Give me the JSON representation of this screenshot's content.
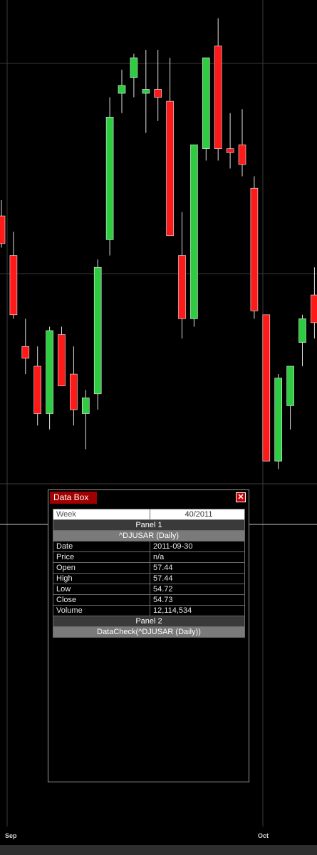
{
  "x_axis": {
    "labels": [
      "Sep",
      "Oct"
    ]
  },
  "colors": {
    "background": "#000000",
    "up_candle": "#2ecc40",
    "down_candle": "#ff1a1a",
    "grid": "#3a3a3a",
    "crosshair": "#c8c8c8"
  },
  "chart_data": {
    "type": "candlestick",
    "title": "",
    "xlabel": "",
    "ylabel": "",
    "x_tick_labels": [
      "Sep",
      "Oct"
    ],
    "series": [
      {
        "candles": [
          {
            "open": 60.9,
            "high": 61.3,
            "low": 60.1,
            "close": 60.2
          },
          {
            "open": 59.9,
            "high": 60.5,
            "low": 58.3,
            "close": 58.4
          },
          {
            "open": 57.6,
            "high": 58.3,
            "low": 56.9,
            "close": 57.3
          },
          {
            "open": 57.1,
            "high": 57.6,
            "low": 55.6,
            "close": 55.9
          },
          {
            "open": 55.9,
            "high": 58.1,
            "low": 55.5,
            "close": 58.0
          },
          {
            "open": 57.9,
            "high": 58.1,
            "low": 56.7,
            "close": 56.6
          },
          {
            "open": 56.9,
            "high": 57.6,
            "low": 55.6,
            "close": 56.0
          },
          {
            "open": 55.9,
            "high": 56.5,
            "low": 55.0,
            "close": 56.3
          },
          {
            "open": 56.4,
            "high": 59.8,
            "low": 56.0,
            "close": 59.6
          },
          {
            "open": 60.3,
            "high": 63.9,
            "low": 59.9,
            "close": 63.4
          },
          {
            "open": 64.0,
            "high": 64.6,
            "low": 63.5,
            "close": 64.2
          },
          {
            "open": 64.4,
            "high": 65.0,
            "low": 63.9,
            "close": 64.9
          },
          {
            "open": 64.0,
            "high": 65.1,
            "low": 63.0,
            "close": 64.1
          },
          {
            "open": 64.1,
            "high": 65.1,
            "low": 63.3,
            "close": 63.9
          },
          {
            "open": 63.8,
            "high": 64.9,
            "low": 60.7,
            "close": 60.4
          },
          {
            "open": 59.9,
            "high": 61.0,
            "low": 57.8,
            "close": 58.3
          },
          {
            "open": 58.3,
            "high": 61.3,
            "low": 58.1,
            "close": 62.7
          },
          {
            "open": 62.6,
            "high": 64.9,
            "low": 62.3,
            "close": 64.9
          },
          {
            "open": 65.2,
            "high": 65.9,
            "low": 62.3,
            "close": 62.6
          },
          {
            "open": 62.6,
            "high": 63.5,
            "low": 62.1,
            "close": 62.5
          },
          {
            "open": 62.7,
            "high": 63.6,
            "low": 61.9,
            "close": 62.2
          },
          {
            "open": 61.6,
            "high": 61.9,
            "low": 58.3,
            "close": 58.5
          },
          {
            "open": 58.4,
            "high": 58.4,
            "low": 54.7,
            "close": 54.7
          },
          {
            "open": 54.7,
            "high": 56.9,
            "low": 54.5,
            "close": 56.8
          },
          {
            "open": 56.1,
            "high": 56.3,
            "low": 55.5,
            "close": 57.1
          },
          {
            "open": 57.7,
            "high": 58.4,
            "low": 57.1,
            "close": 58.3
          },
          {
            "open": 58.9,
            "high": 59.6,
            "low": 57.8,
            "close": 58.2
          }
        ]
      }
    ],
    "grid": true
  },
  "data_box": {
    "title": "Data Box",
    "close_glyph": "✕",
    "week_label": "Week",
    "week_value": "40/2011",
    "panel1": "Panel 1",
    "symbol": "^DJUSAR (Daily)",
    "fields": [
      {
        "key": "Date",
        "value": "2011-09-30"
      },
      {
        "key": "Price",
        "value": "n/a"
      },
      {
        "key": "Open",
        "value": "57.44"
      },
      {
        "key": "High",
        "value": "57.44"
      },
      {
        "key": "Low",
        "value": "54.72"
      },
      {
        "key": "Close",
        "value": "54.73"
      },
      {
        "key": "Volume",
        "value": "12,114,534"
      }
    ],
    "panel2": "Panel 2",
    "datacheck": "DataCheck(^DJUSAR (Daily))"
  }
}
